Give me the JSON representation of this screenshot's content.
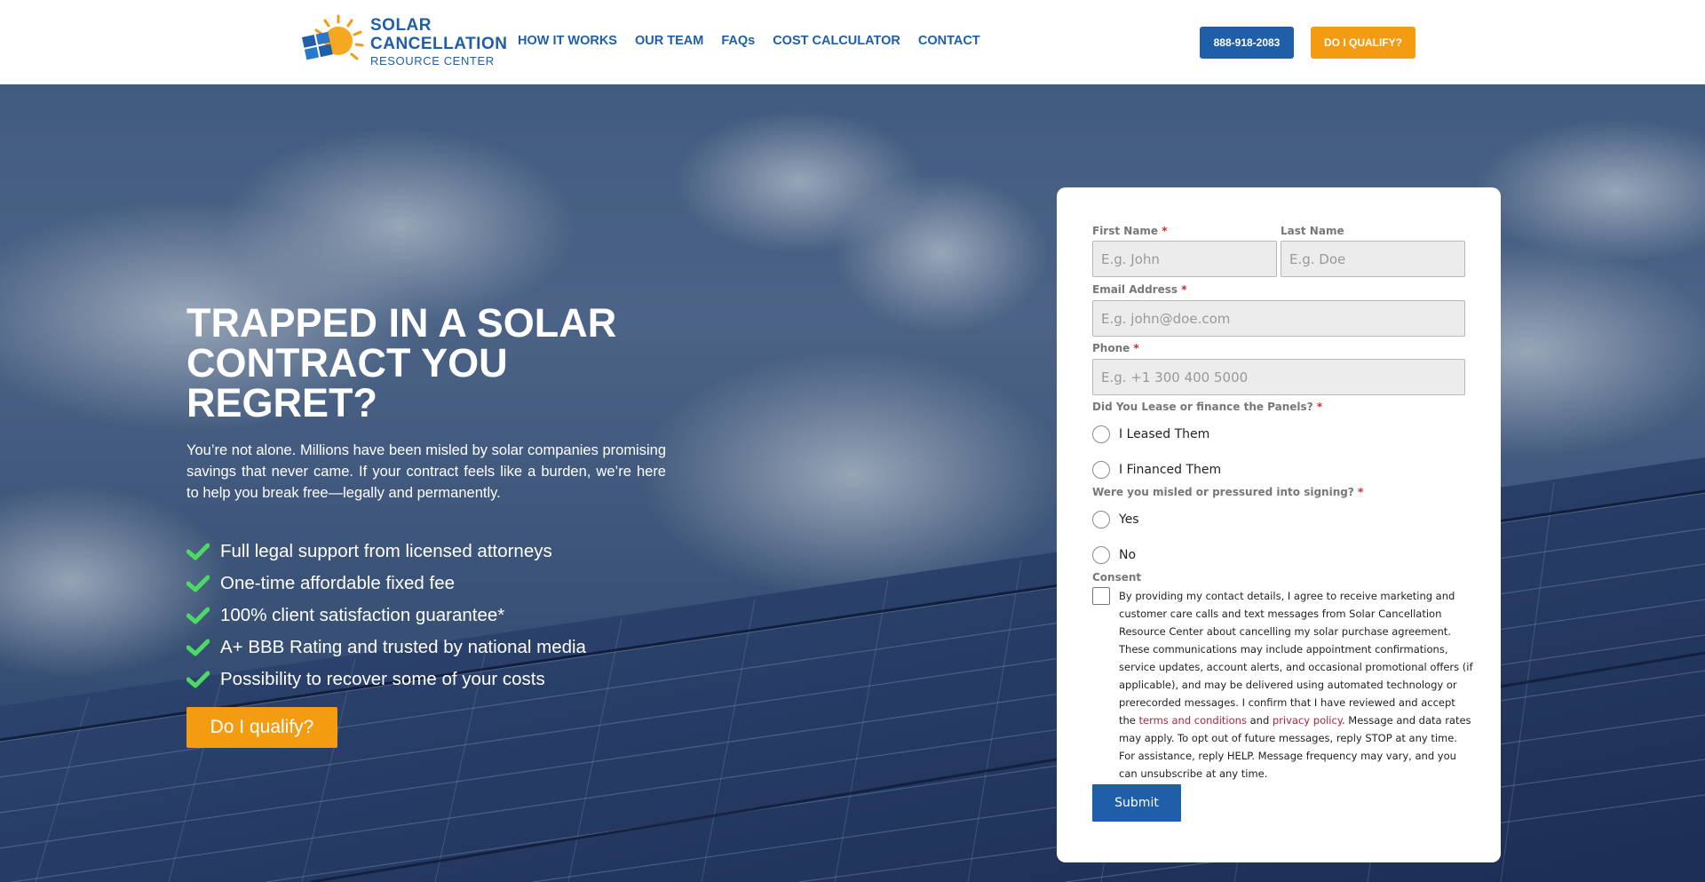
{
  "logo": {
    "line1": "SOLAR",
    "line2": "CANCELLATION",
    "line3": "RESOURCE CENTER"
  },
  "nav": [
    {
      "label": "HOW IT WORKS"
    },
    {
      "label": "OUR TEAM"
    },
    {
      "label": "FAQs"
    },
    {
      "label": "COST CALCULATOR"
    },
    {
      "label": "CONTACT"
    }
  ],
  "header_buttons": {
    "phone": "888-918-2083",
    "qualify": "DO I QUALIFY?"
  },
  "hero": {
    "title": "TRAPPED IN A SOLAR CONTRACT YOU REGRET?",
    "subtitle": "You’re not alone. Millions have been misled by solar companies promising savings that never came. If your contract feels like a burden, we’re here to help you break free—legally and permanently.",
    "bullets": [
      "Full legal support from licensed attorneys",
      "One-time affordable fixed fee",
      "100% client satisfaction guarantee*",
      "A+ BBB Rating and trusted by national media",
      "Possibility to recover some of your costs"
    ],
    "cta": "Do I qualify?"
  },
  "form": {
    "first_name": {
      "label": "First Name",
      "placeholder": "E.g. John"
    },
    "last_name": {
      "label": "Last Name",
      "placeholder": "E.g. Doe"
    },
    "email": {
      "label": "Email Address",
      "placeholder": "E.g. john@doe.com"
    },
    "phone": {
      "label": "Phone",
      "placeholder": "E.g. +1 300 400 5000"
    },
    "q_lease": {
      "label": "Did You Lease or finance the Panels?",
      "options": [
        "I Leased Them",
        "I Financed Them"
      ]
    },
    "q_misled": {
      "label": "Were you misled or pressured into signing?",
      "options": [
        "Yes",
        "No"
      ]
    },
    "consent": {
      "label": "Consent",
      "text_before": "By providing my contact details, I agree to receive marketing and customer care calls and text messages from Solar Cancellation Resource Center about cancelling my solar purchase agreement. These communications may include appointment confirmations, service updates, account alerts, and occasional promotional offers (if applicable), and may be delivered using automated technology or prerecorded messages. I confirm that I have reviewed and accept the ",
      "terms_link": "terms and conditions",
      "and": " and ",
      "privacy_link": "privacy policy",
      "text_after": ". Message and data rates may apply. To opt out of future messages, reply STOP at any time. For assistance, reply HELP. Message frequency may vary, and you can unsubscribe at any time."
    },
    "required_mark": "*",
    "submit": "Submit"
  },
  "colors": {
    "brand_blue": "#1f5ea8",
    "accent_orange": "#f39c12",
    "check_green": "#4cd964",
    "link_red": "#b0243a"
  }
}
